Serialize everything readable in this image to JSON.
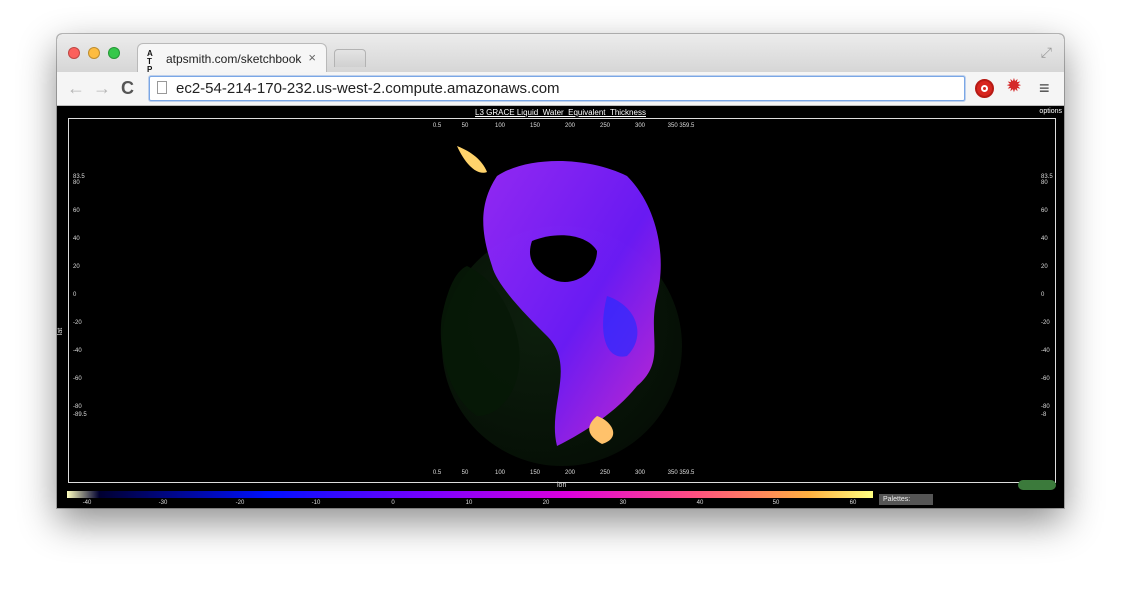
{
  "browser": {
    "tab": {
      "favicon": "A T\nP S",
      "title": "atpsmith.com/sketchbook",
      "close": "×"
    },
    "toolbar": {
      "back": "←",
      "forward": "→",
      "reload": "C",
      "url": "ec2-54-214-170-232.us-west-2.compute.amazonaws.com"
    },
    "icons": {
      "menu": "≡"
    }
  },
  "viz": {
    "title": "L3 GRACE Liquid_Water_Equivalent_Thickness",
    "options": "options",
    "lon_label": "lon",
    "lat_label": "lat",
    "lon_ticks": [
      "0.5",
      "50",
      "100",
      "150",
      "200",
      "250",
      "300",
      "350 359.5"
    ],
    "lat_ticks_left": [
      "83.5",
      "80",
      "60",
      "40",
      "20",
      "0",
      "-20",
      "-40",
      "-60",
      "-80",
      "-89.5"
    ],
    "lat_ticks_right": [
      "83.5",
      "80",
      "60",
      "40",
      "20",
      "0",
      "-20",
      "-40",
      "-60",
      "-80",
      "-8"
    ],
    "colorbar_ticks": [
      "-40",
      "-30",
      "-20",
      "-10",
      "0",
      "10",
      "20",
      "30",
      "40",
      "50",
      "60"
    ],
    "palettes_label": "Palettes:"
  }
}
